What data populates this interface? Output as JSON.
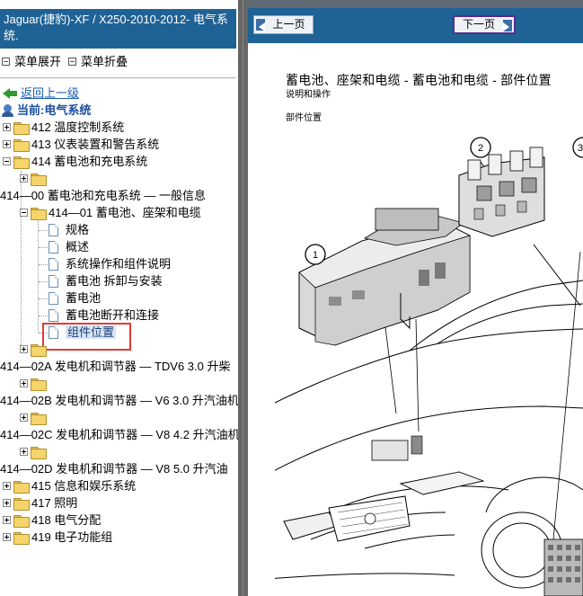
{
  "left_pane": {
    "title": "Jaguar(捷豹)-XF / X250-2010-2012- 电气系统.",
    "menu": {
      "expand_label": "菜单展开",
      "collapse_label": "菜单折叠"
    },
    "back_label": "返回上一级",
    "current_label": "当前:电气系统",
    "tree": [
      {
        "id": "n412",
        "label": "412 温度控制系统"
      },
      {
        "id": "n413",
        "label": "413 仪表装置和警告系统"
      },
      {
        "id": "n414",
        "label": "414 蓄电池和充电系统"
      },
      {
        "id": "n414_00",
        "label": "414—00 蓄电池和充电系统 — 一般信息"
      },
      {
        "id": "n414_01",
        "label": "414—01 蓄电池、座架和电缆"
      },
      {
        "id": "d1",
        "label": "规格"
      },
      {
        "id": "d2",
        "label": "概述"
      },
      {
        "id": "d3",
        "label": "系统操作和组件说明"
      },
      {
        "id": "d4",
        "label": "蓄电池 拆卸与安装"
      },
      {
        "id": "d5",
        "label": "蓄电池"
      },
      {
        "id": "d6",
        "label": "蓄电池断开和连接"
      },
      {
        "id": "d7",
        "label": "组件位置"
      },
      {
        "id": "n414_02a",
        "label": "414—02A 发电机和调节器 — TDV6 3.0 升柴"
      },
      {
        "id": "n414_02b",
        "label": "414—02B 发电机和调节器 — V6 3.0 升汽油机"
      },
      {
        "id": "n414_02c",
        "label": "414—02C 发电机和调节器 — V8 4.2 升汽油机"
      },
      {
        "id": "n414_02d",
        "label": "414—02D 发电机和调节器 — V8 5.0 升汽油"
      },
      {
        "id": "n415",
        "label": "415 信息和娱乐系统"
      },
      {
        "id": "n417",
        "label": "417 照明"
      },
      {
        "id": "n418",
        "label": "418 电气分配"
      },
      {
        "id": "n419",
        "label": "419 电子功能组"
      }
    ]
  },
  "right_pane": {
    "prev_label": "上一页",
    "next_label": "下一页",
    "doc_title": "蓄电池、座架和电缆 - 蓄电池和电缆  - 部件位置",
    "doc_sub1": "说明和操作",
    "doc_sub2": "部件位置",
    "diagram_callouts": [
      "1",
      "2",
      "3"
    ]
  },
  "colors": {
    "header_blue": "#1f6295",
    "highlight_red": "#e53935",
    "link_blue": "#1a5fb4",
    "folder_yellow": "#f5d56b"
  }
}
